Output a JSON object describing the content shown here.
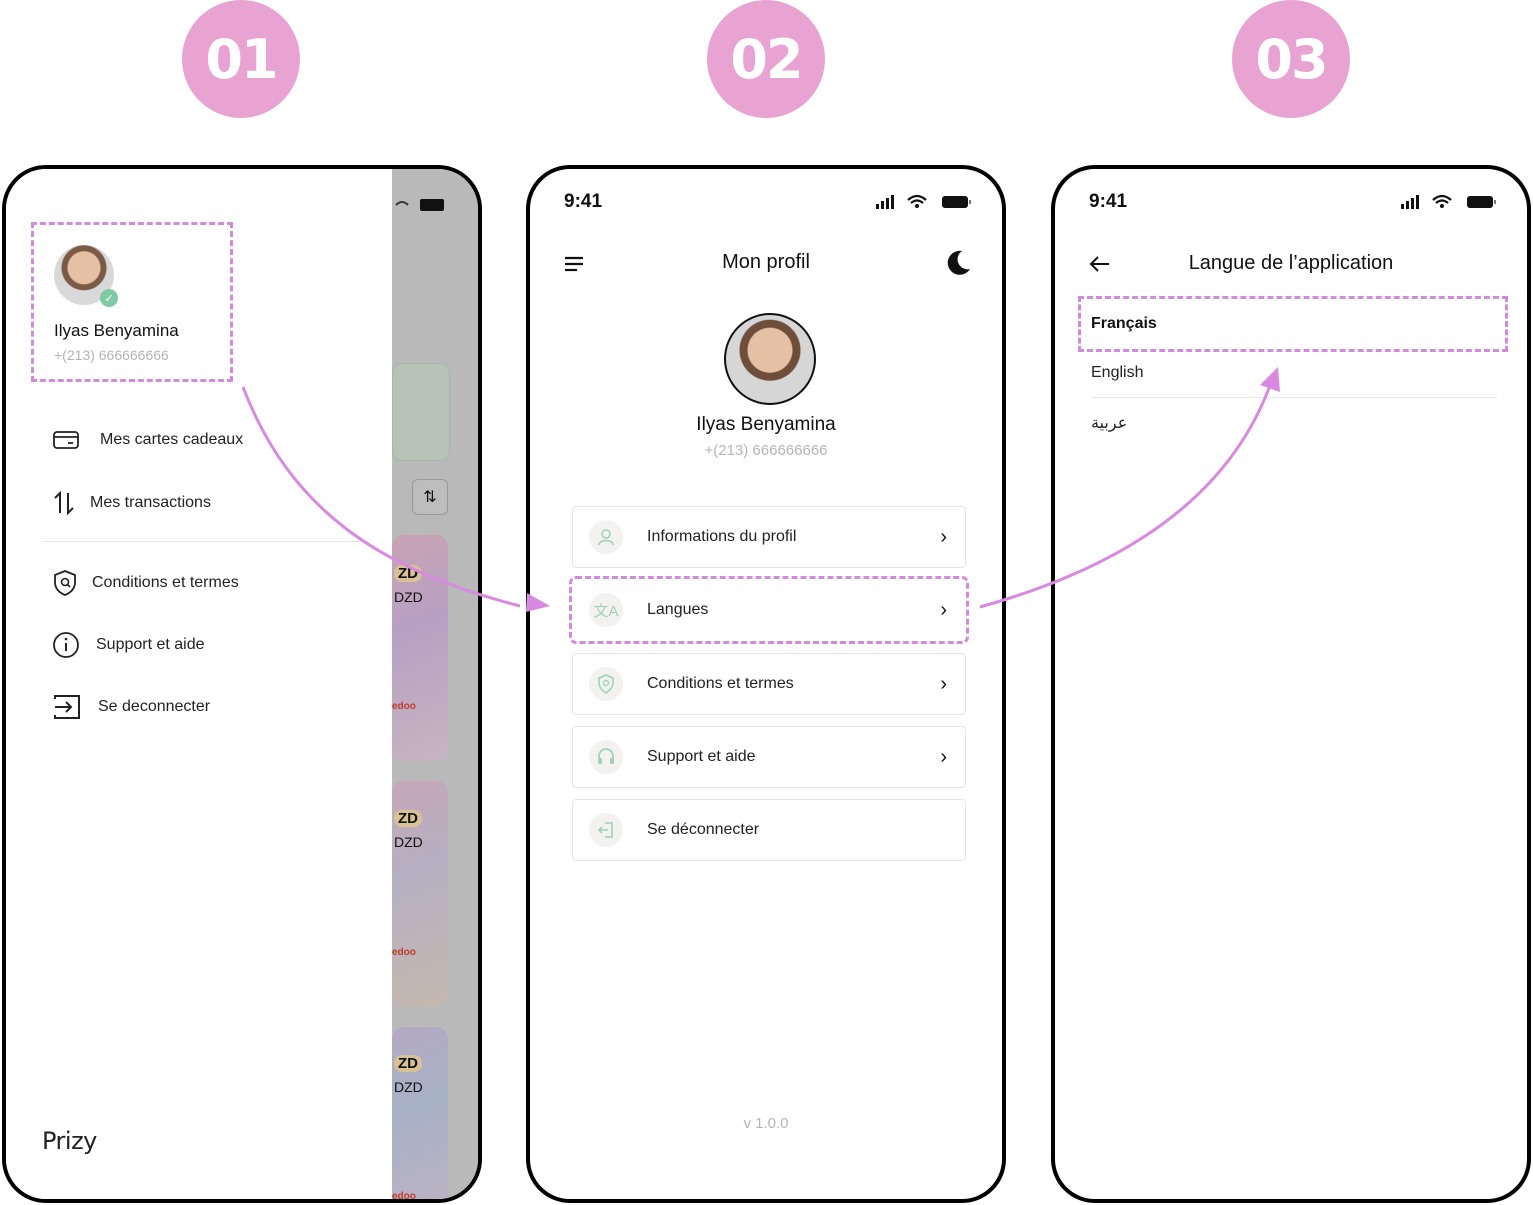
{
  "steps": [
    "01",
    "02",
    "03"
  ],
  "screen1": {
    "user_name": "Ilyas Benyamina",
    "user_phone": "+(213) 666666666",
    "menu": [
      {
        "label": "Mes cartes cadeaux",
        "icon": "card-icon"
      },
      {
        "label": "Mes transactions",
        "icon": "swap-icon"
      },
      {
        "label": "Conditions et termes",
        "icon": "shield-icon"
      },
      {
        "label": "Support et aide",
        "icon": "info-icon"
      },
      {
        "label": "Se deconnecter",
        "icon": "logout-icon"
      }
    ],
    "brand": "Prizy",
    "background_cards": [
      "ZD",
      "DZD",
      "edoo",
      "ZD",
      "DZD",
      "edoo",
      "ZD",
      "DZD",
      "edoo"
    ]
  },
  "screen2": {
    "time": "9:41",
    "title": "Mon profil",
    "user_name": "Ilyas Benyamina",
    "user_phone": "+(213) 666666666",
    "items": [
      {
        "label": "Informations du profil",
        "icon": "user-icon"
      },
      {
        "label": "Langues",
        "icon": "translate-icon"
      },
      {
        "label": "Conditions et termes",
        "icon": "shield-icon"
      },
      {
        "label": "Support et aide",
        "icon": "headset-icon"
      },
      {
        "label": "Se déconnecter",
        "icon": "logout-icon"
      }
    ],
    "version": "v 1.0.0"
  },
  "screen3": {
    "time": "9:41",
    "title": "Langue de l’application",
    "languages": [
      "Français",
      "English",
      "عربية"
    ]
  },
  "colors": {
    "accent": "#e8a3d3",
    "dash": "#d28adc",
    "arrow": "#d98ae0",
    "muted": "#b5b5b5",
    "icon_green": "#9fd3b8"
  }
}
